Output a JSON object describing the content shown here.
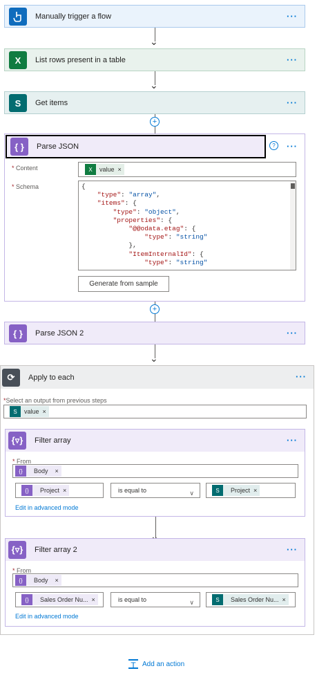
{
  "steps": {
    "trigger": {
      "title": "Manually trigger a flow",
      "more": "···"
    },
    "list_rows": {
      "title": "List rows present in a table",
      "more": "···"
    },
    "get_items": {
      "title": "Get items",
      "more": "···"
    },
    "parse_json": {
      "title": "Parse JSON",
      "help": "?",
      "more": "···",
      "content_label": "Content",
      "content_token": "value",
      "schema_label": "Schema",
      "schema_lines": [
        "{",
        "    \"type\": \"array\",",
        "    \"items\": {",
        "        \"type\": \"object\",",
        "        \"properties\": {",
        "            \"@@odata.etag\": {",
        "                \"type\": \"string\"",
        "            },",
        "            \"ItemInternalId\": {",
        "                \"type\": \"string\""
      ],
      "generate_button": "Generate from sample"
    },
    "parse_json_2": {
      "title": "Parse JSON 2",
      "more": "···"
    },
    "apply_each": {
      "title": "Apply to each",
      "more": "···",
      "select_label": "Select an output from previous steps",
      "select_token": "value"
    },
    "filter_array": {
      "title": "Filter array",
      "more": "···",
      "from_label": "From",
      "from_token": "Body",
      "left_token": "Project",
      "operator": "is equal to",
      "right_token": "Project",
      "advanced_link": "Edit in advanced mode"
    },
    "filter_array_2": {
      "title": "Filter array 2",
      "more": "···",
      "from_label": "From",
      "from_token": "Body",
      "left_token": "Sales Order Nu...",
      "operator": "is equal to",
      "right_token": "Sales Order Nu...",
      "advanced_link": "Edit in advanced mode"
    }
  },
  "add_action": "Add an action",
  "colors": {
    "trigger": "#0f6cbd",
    "excel": "#107c41",
    "sharepoint": "#036c70",
    "data_op": "#8661c5",
    "control": "#484f58",
    "link": "#0078d4"
  },
  "icons": {
    "trigger": "hand-pointer-icon",
    "excel": "excel-icon",
    "sharepoint": "sharepoint-icon",
    "parse": "curly-braces-icon",
    "filter": "filter-braces-icon",
    "loop": "loop-icon"
  }
}
